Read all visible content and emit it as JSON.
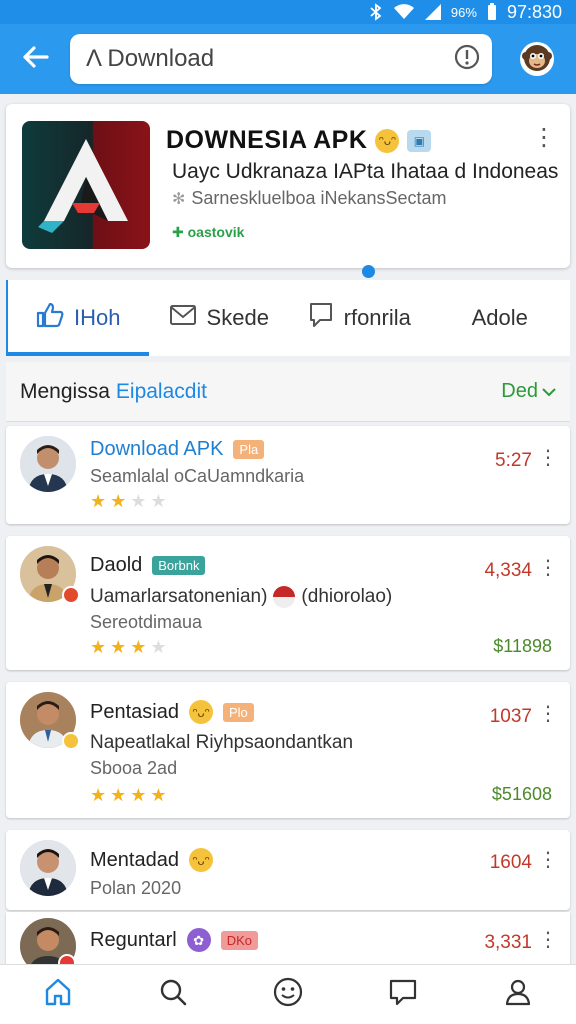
{
  "status_bar": {
    "battery": "96%",
    "time": "97:830"
  },
  "search": {
    "value": "Λ Download"
  },
  "app": {
    "title": "DOWNESIA APK",
    "description": "Uayc Udkranaza IAPta Ihataa d Indoneas",
    "tagline": "Sarneskluelboa iNekansSectam",
    "link": "oastovik"
  },
  "tabs": [
    {
      "label": "IHoh"
    },
    {
      "label": "Skede"
    },
    {
      "label": "rfonrila"
    },
    {
      "label": "Adole"
    }
  ],
  "section": {
    "title": "Mengissa",
    "accent": "Eipalacdit",
    "filter": "Ded"
  },
  "rows": [
    {
      "title": "Download APK",
      "tag": "Pla",
      "line1": "Seamlalal oCaUamndkaria",
      "value": "5:27",
      "stars_filled": 2,
      "stars_total": 4
    },
    {
      "title": "Daold",
      "tag": "Borbnk",
      "line1": "Uamarlarsatonenian)",
      "line1_extra": "(dhiorolao)",
      "line2": "Sereotdimaua",
      "value": "4,334",
      "price": "$11898",
      "stars_filled": 3,
      "stars_total": 4
    },
    {
      "title": "Pentasiad",
      "tag": "Plo",
      "line1": "Napeatlakal Riyhpsaondantkan",
      "line2": "Sbooa 2ad",
      "value": "1037",
      "price": "$51608",
      "stars_filled": 4,
      "stars_total": 4
    },
    {
      "title": "Mentadad",
      "line1": "Polan 2020",
      "value": "1604"
    },
    {
      "title": "Reguntarl",
      "tag": "DKo",
      "value": "3,331"
    }
  ],
  "colors": {
    "primary": "#2a99ee",
    "accent": "#1e88e5",
    "price_red": "#c0392b",
    "price_green": "#4b8a2a",
    "star": "#f1b21b"
  },
  "icons": {
    "back": "arrow-left-icon",
    "info": "info-circle-icon",
    "profile": "monkey-avatar-icon",
    "bottom_nav": [
      "home-icon",
      "search-icon",
      "smile-icon",
      "chat-icon",
      "profile-icon"
    ]
  }
}
